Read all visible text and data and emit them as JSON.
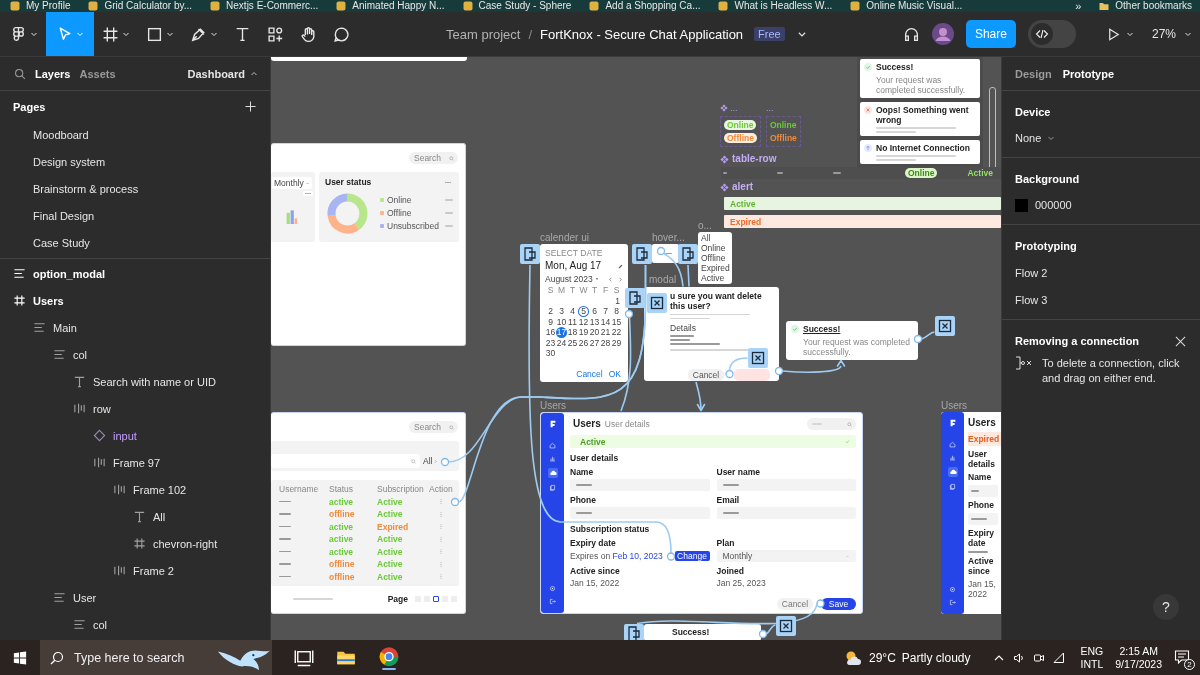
{
  "bookmarks": {
    "items": [
      "My Profile",
      "Grid Calculator by...",
      "Nextjs E-Commerc...",
      "Animated Happy N...",
      "Case Study - Sphere",
      "Add a Shopping Ca...",
      "What is Headless W...",
      "Online Music Visual..."
    ],
    "more": "»",
    "other": "Other bookmarks"
  },
  "toolbar": {
    "tools": [
      {
        "kind": "menu",
        "selected": false,
        "has_menu": true
      },
      {
        "kind": "move",
        "selected": true,
        "has_menu": true
      },
      {
        "kind": "frame",
        "selected": false,
        "has_menu": true
      },
      {
        "kind": "shape",
        "selected": false,
        "has_menu": true
      },
      {
        "kind": "pen",
        "selected": false,
        "has_menu": true
      },
      {
        "kind": "text",
        "selected": false,
        "has_menu": false
      },
      {
        "kind": "resources",
        "selected": false,
        "has_menu": false
      },
      {
        "kind": "hand",
        "selected": false,
        "has_menu": false
      },
      {
        "kind": "comment",
        "selected": false,
        "has_menu": false
      }
    ],
    "team": "Team project",
    "separator": "/",
    "file": "FortKnox - Secure Chat Application",
    "plan": "Free",
    "share": "Share",
    "dev_mode": {
      "on": false
    },
    "zoom": "27%"
  },
  "left_panel": {
    "tabs": [
      {
        "label": "Layers",
        "selected": true
      },
      {
        "label": "Assets",
        "selected": false
      }
    ],
    "page_menu": "Dashboard",
    "pages_title": "Pages",
    "pages": [
      "Moodboard",
      "Design system",
      "Brainstorm & process",
      "Final Design",
      "Case Study"
    ],
    "layers": [
      {
        "name": "option_modal",
        "kind": "stack"
      },
      {
        "name": "Users",
        "kind": "frame",
        "children": [
          {
            "name": "Main",
            "kind": "stack",
            "children": [
              {
                "name": "col",
                "kind": "stack",
                "children": [
                  {
                    "name": "Search with name or UID",
                    "kind": "text"
                  },
                  {
                    "name": "row",
                    "kind": "row",
                    "children": [
                      {
                        "name": "input",
                        "kind": "component"
                      },
                      {
                        "name": "Frame 97",
                        "kind": "row",
                        "children": [
                          {
                            "name": "Frame 102",
                            "kind": "row",
                            "children": [
                              {
                                "name": "All",
                                "kind": "text"
                              },
                              {
                                "name": "chevron-right",
                                "kind": "frame"
                              }
                            ]
                          },
                          {
                            "name": "Frame 2",
                            "kind": "row"
                          }
                        ]
                      }
                    ]
                  }
                ]
              },
              {
                "name": "User",
                "kind": "stack",
                "children": [
                  {
                    "name": "col",
                    "kind": "stack"
                  }
                ]
              }
            ]
          }
        ]
      }
    ]
  },
  "canvas": {
    "dashboard": {
      "search": {
        "placeholder": "Search"
      },
      "filter": "Monthly",
      "status_title": "User status",
      "legend": [
        {
          "label": "Online",
          "color": "#b8e68a"
        },
        {
          "label": "Offline",
          "color": "#ffb38a"
        },
        {
          "label": "Unsubscribed",
          "color": "#a9b4f2"
        }
      ]
    },
    "toasts": [
      {
        "kind": "success",
        "title": "Success!",
        "text": "Your request was completed successfully."
      },
      {
        "kind": "error",
        "title": "Oops! Something went wrong"
      },
      {
        "kind": "offline",
        "title": "No Internet Connection"
      }
    ],
    "component_sets": [
      {
        "label": "...",
        "component_icon": true,
        "kind": "badge",
        "items": [
          {
            "text": "Online",
            "color": "#6cc93a"
          },
          {
            "text": "Offline",
            "color": "#f08a3c"
          }
        ]
      },
      {
        "label": "...",
        "component_icon": false,
        "kind": "text",
        "items": [
          {
            "text": "Online",
            "color": "#6cc93a"
          },
          {
            "text": "Offline",
            "color": "#f08a3c"
          }
        ]
      }
    ],
    "table_row": {
      "label": "table-row",
      "badge": "Online",
      "status": "Active"
    },
    "alert": {
      "label": "alert",
      "items": [
        {
          "text": "Active",
          "color": "#5fb52e"
        },
        {
          "text": "Expired",
          "color": "#f06a2a"
        }
      ]
    },
    "calendar": {
      "label": "calender ui",
      "heading": "SELECT DATE",
      "date": "Mon, Aug 17",
      "month": "August 2023",
      "weekdays": [
        "S",
        "M",
        "T",
        "W",
        "T",
        "F",
        "S"
      ],
      "weeks": [
        [
          {
            "label": "1",
            "selected": false,
            "today": false
          }
        ],
        [
          {
            "label": "2",
            "selected": false,
            "today": false
          },
          {
            "label": "3",
            "selected": false,
            "today": false
          },
          {
            "label": "4",
            "selected": false,
            "today": false
          },
          {
            "label": "5",
            "selected": false,
            "today": true
          },
          {
            "label": "6",
            "selected": false,
            "today": false
          },
          {
            "label": "7",
            "selected": false,
            "today": false
          },
          {
            "label": "8",
            "selected": false,
            "today": false
          }
        ],
        [
          {
            "label": "9",
            "selected": false,
            "today": false
          },
          {
            "label": "10",
            "selected": false,
            "today": false
          },
          {
            "label": "11",
            "selected": false,
            "today": false
          },
          {
            "label": "12",
            "selected": false,
            "today": false
          },
          {
            "label": "13",
            "selected": false,
            "today": false
          },
          {
            "label": "14",
            "selected": false,
            "today": false
          },
          {
            "label": "15",
            "selected": false,
            "today": false
          }
        ],
        [
          {
            "label": "16",
            "selected": false,
            "today": false
          },
          {
            "label": "17",
            "selected": true,
            "today": false
          },
          {
            "label": "18",
            "selected": false,
            "today": false
          },
          {
            "label": "19",
            "selected": false,
            "today": false
          },
          {
            "label": "20",
            "selected": false,
            "today": false
          },
          {
            "label": "21",
            "selected": false,
            "today": false
          },
          {
            "label": "22",
            "selected": false,
            "today": false
          }
        ],
        [
          {
            "label": "23",
            "selected": false,
            "today": false
          },
          {
            "label": "24",
            "selected": false,
            "today": false
          },
          {
            "label": "25",
            "selected": false,
            "today": false
          },
          {
            "label": "26",
            "selected": false,
            "today": false
          },
          {
            "label": "27",
            "selected": false,
            "today": false
          },
          {
            "label": "28",
            "selected": false,
            "today": false
          },
          {
            "label": "29",
            "selected": false,
            "today": false
          }
        ],
        [
          {
            "label": "30",
            "selected": false,
            "today": false
          }
        ]
      ],
      "actions": [
        "Cancel",
        "OK"
      ]
    },
    "hover": {
      "label": "hover..."
    },
    "dropdown": {
      "label": "o...",
      "options": [
        "All",
        "Online",
        "Offline",
        "Expired",
        "Active"
      ]
    },
    "modal": {
      "label": "modal",
      "title": "u sure you want delete this user?",
      "details_title": "Details",
      "cancel": "Cancel"
    },
    "success": {
      "title": "Success!",
      "text": "Your request was completed successfully."
    },
    "users_list": {
      "search": {
        "placeholder": "Search"
      },
      "filter": "All",
      "columns": [
        "Username",
        "Status",
        "Subscription",
        "Action"
      ],
      "rows": [
        {
          "status": {
            "text": "active",
            "color": "#6cc93a"
          },
          "subscription": {
            "text": "Active",
            "color": "#6cc93a"
          }
        },
        {
          "status": {
            "text": "offline",
            "color": "#f08a3c"
          },
          "subscription": {
            "text": "Active",
            "color": "#6cc93a"
          }
        },
        {
          "status": {
            "text": "active",
            "color": "#6cc93a"
          },
          "subscription": {
            "text": "Expired",
            "color": "#f08a3c"
          }
        },
        {
          "status": {
            "text": "active",
            "color": "#6cc93a"
          },
          "subscription": {
            "text": "Active",
            "color": "#6cc93a"
          }
        },
        {
          "status": {
            "text": "active",
            "color": "#6cc93a"
          },
          "subscription": {
            "text": "Active",
            "color": "#6cc93a"
          }
        },
        {
          "status": {
            "text": "offline",
            "color": "#f08a3c"
          },
          "subscription": {
            "text": "Active",
            "color": "#6cc93a"
          }
        },
        {
          "status": {
            "text": "offline",
            "color": "#f08a3c"
          },
          "subscription": {
            "text": "Active",
            "color": "#6cc93a"
          }
        }
      ],
      "page_label": "Page",
      "pages": [
        {
          "selected": false
        },
        {
          "selected": false
        },
        {
          "selected": true
        },
        {
          "selected": false
        },
        {
          "selected": false
        }
      ]
    },
    "users_detail": {
      "label": "Users",
      "title": "Users",
      "subtitle": "User details",
      "alert": "Active",
      "section": "User details",
      "fields": [
        "Name",
        "User name",
        "Phone",
        "Email"
      ],
      "subscription_title": "Subscription status",
      "expiry_label": "Expiry date",
      "expiry_text": "Expires on",
      "expiry_date": "Feb 10, 2023",
      "change": "Change",
      "plan_label": "Plan",
      "plan": "Monthly",
      "since_label": "Active since",
      "since": "Jan 15, 2022",
      "joined_label": "Joined",
      "joined": "Jan 25, 2023",
      "cancel": "Cancel",
      "save": "Save"
    },
    "users_side": {
      "label": "Users",
      "title": "Users",
      "alert": "Expired",
      "section": "User details",
      "name_label": "Name",
      "phone_label": "Phone",
      "expiry_label": "Expiry date",
      "since_label": "Active since",
      "since": "Jan 15, 2022"
    },
    "bottom_toast": {
      "title": "Success!"
    }
  },
  "right_panel": {
    "tabs": [
      {
        "label": "Design",
        "selected": false
      },
      {
        "label": "Prototype",
        "selected": true
      }
    ],
    "device_title": "Device",
    "device": "None",
    "background_title": "Background",
    "background": "000000",
    "prototyping_title": "Prototyping",
    "flows": [
      "Flow 2",
      "Flow 3"
    ],
    "hint_title": "Removing a connection",
    "hint": "To delete a connection, click and drag on either end.",
    "help": "?"
  },
  "taskbar": {
    "search": {
      "placeholder": "Type here to search"
    },
    "temperature": "29°C",
    "weather": "Partly cloudy",
    "language": "ENG",
    "layout": "INTL",
    "time": "2:15 AM",
    "date": "9/17/2023",
    "notifications": "2"
  }
}
